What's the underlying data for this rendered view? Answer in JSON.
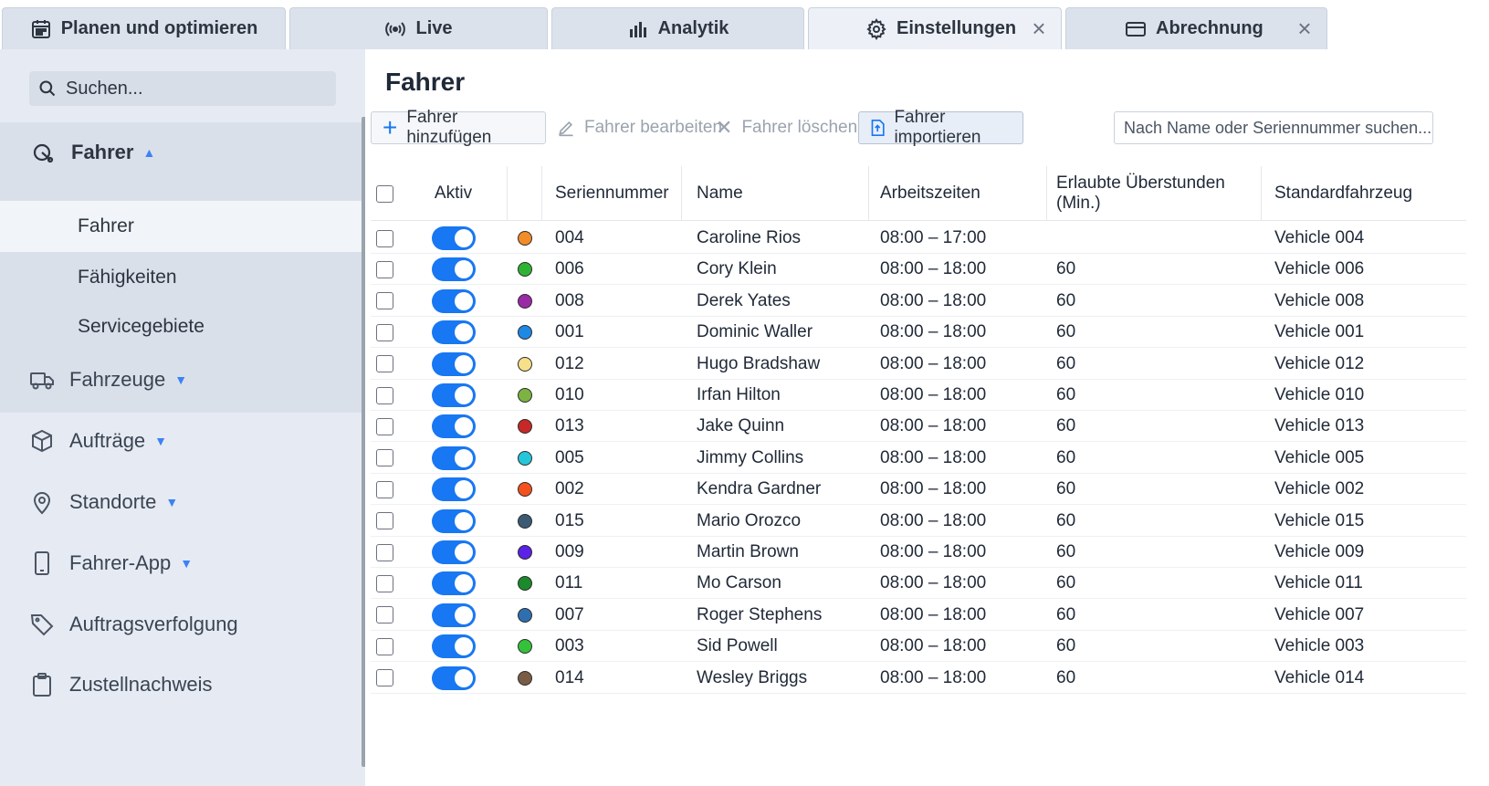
{
  "tabs": [
    {
      "label": "Planen und optimieren",
      "icon": "calendar-icon"
    },
    {
      "label": "Live",
      "icon": "broadcast-icon"
    },
    {
      "label": "Analytik",
      "icon": "bar-chart-icon"
    },
    {
      "label": "Einstellungen",
      "icon": "gear-icon",
      "active": true,
      "closable": true
    },
    {
      "label": "Abrechnung",
      "icon": "card-icon",
      "closable": true
    }
  ],
  "sidebar": {
    "search_placeholder": "Suchen...",
    "group": {
      "label": "Fahrer",
      "icon": "driver-icon",
      "items": [
        {
          "label": "Fahrer",
          "active": true
        },
        {
          "label": "Fähigkeiten"
        },
        {
          "label": "Servicegebiete"
        }
      ]
    },
    "items": [
      {
        "label": "Fahrzeuge",
        "icon": "truck-icon",
        "caret": true
      },
      {
        "label": "Aufträge",
        "icon": "box-icon",
        "caret": true
      },
      {
        "label": "Standorte",
        "icon": "location-pin-icon",
        "caret": true
      },
      {
        "label": "Fahrer-App",
        "icon": "phone-icon",
        "caret": true
      },
      {
        "label": "Auftragsverfolgung",
        "icon": "tag-icon",
        "caret": false
      },
      {
        "label": "Zustellnachweis",
        "icon": "clipboard-icon",
        "caret": false
      }
    ]
  },
  "main": {
    "title": "Fahrer",
    "toolbar": {
      "add": "Fahrer hinzufügen",
      "edit": "Fahrer bearbeiten",
      "delete": "Fahrer löschen",
      "import": "Fahrer importieren",
      "search_placeholder": "Nach Name oder Seriennummer suchen..."
    },
    "columns": {
      "active": "Aktiv",
      "serial": "Seriennummer",
      "name": "Name",
      "hours": "Arbeitszeiten",
      "overtime": "Erlaubte Überstunden (Min.)",
      "vehicle": "Standardfahrzeug"
    },
    "rows": [
      {
        "serial": "004",
        "name": "Caroline Rios",
        "hours": "08:00 – 17:00",
        "overtime": "",
        "vehicle": "Vehicle 004",
        "color": "#f28c28"
      },
      {
        "serial": "006",
        "name": "Cory Klein",
        "hours": "08:00 – 18:00",
        "overtime": "60",
        "vehicle": "Vehicle 006",
        "color": "#2fb335"
      },
      {
        "serial": "008",
        "name": "Derek Yates",
        "hours": "08:00 – 18:00",
        "overtime": "60",
        "vehicle": "Vehicle 008",
        "color": "#9b2aa6"
      },
      {
        "serial": "001",
        "name": "Dominic Waller",
        "hours": "08:00 – 18:00",
        "overtime": "60",
        "vehicle": "Vehicle 001",
        "color": "#1e88e5"
      },
      {
        "serial": "012",
        "name": "Hugo Bradshaw",
        "hours": "08:00 – 18:00",
        "overtime": "60",
        "vehicle": "Vehicle 012",
        "color": "#f6e08a"
      },
      {
        "serial": "010",
        "name": "Irfan Hilton",
        "hours": "08:00 – 18:00",
        "overtime": "60",
        "vehicle": "Vehicle 010",
        "color": "#7cb342"
      },
      {
        "serial": "013",
        "name": "Jake Quinn",
        "hours": "08:00 – 18:00",
        "overtime": "60",
        "vehicle": "Vehicle 013",
        "color": "#c62828"
      },
      {
        "serial": "005",
        "name": "Jimmy Collins",
        "hours": "08:00 – 18:00",
        "overtime": "60",
        "vehicle": "Vehicle 005",
        "color": "#26c6da"
      },
      {
        "serial": "002",
        "name": "Kendra Gardner",
        "hours": "08:00 – 18:00",
        "overtime": "60",
        "vehicle": "Vehicle 002",
        "color": "#f4511e"
      },
      {
        "serial": "015",
        "name": "Mario Orozco",
        "hours": "08:00 – 18:00",
        "overtime": "60",
        "vehicle": "Vehicle 015",
        "color": "#3d5a73"
      },
      {
        "serial": "009",
        "name": "Martin Brown",
        "hours": "08:00 – 18:00",
        "overtime": "60",
        "vehicle": "Vehicle 009",
        "color": "#5b21e6"
      },
      {
        "serial": "011",
        "name": "Mo Carson",
        "hours": "08:00 – 18:00",
        "overtime": "60",
        "vehicle": "Vehicle 011",
        "color": "#1b8a2a"
      },
      {
        "serial": "007",
        "name": "Roger Stephens",
        "hours": "08:00 – 18:00",
        "overtime": "60",
        "vehicle": "Vehicle 007",
        "color": "#2f6fb0"
      },
      {
        "serial": "003",
        "name": "Sid Powell",
        "hours": "08:00 – 18:00",
        "overtime": "60",
        "vehicle": "Vehicle 003",
        "color": "#33c23a"
      },
      {
        "serial": "014",
        "name": "Wesley Briggs",
        "hours": "08:00 – 18:00",
        "overtime": "60",
        "vehicle": "Vehicle 014",
        "color": "#7a5c45"
      }
    ]
  }
}
